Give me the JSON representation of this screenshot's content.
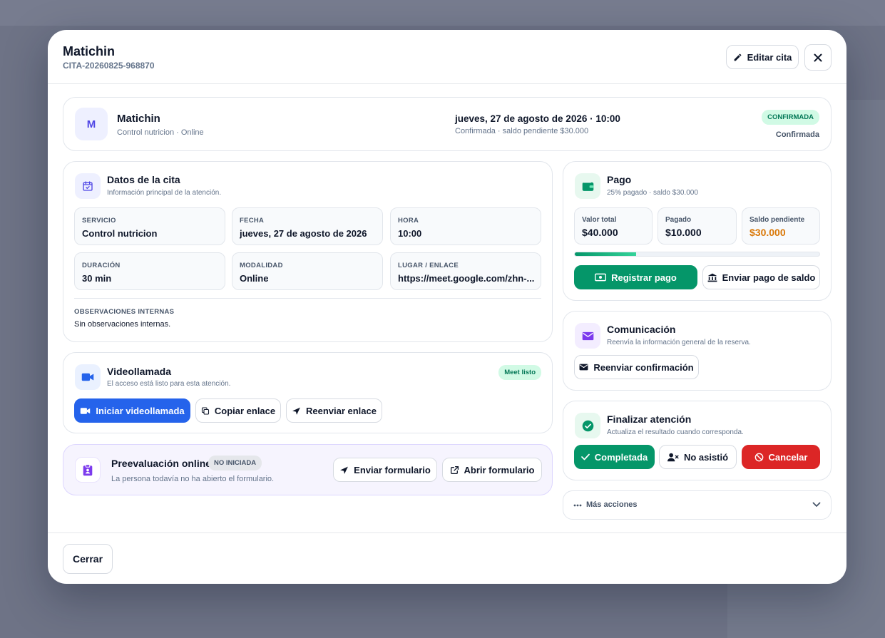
{
  "modal": {
    "title": "Matichin",
    "code": "CITA-20260825-968870",
    "edit_label": "Editar cita",
    "close_icon": "close-icon"
  },
  "summary": {
    "avatar_initial": "M",
    "name": "Matichin",
    "service_line": "Control nutricion · Online",
    "datetime": "jueves, 27 de agosto de 2026 · 10:00",
    "status_line": "Confirmada · saldo pendiente $30.000",
    "badge": "CONFIRMADA",
    "status": "Confirmada"
  },
  "details": {
    "title": "Datos de la cita",
    "subtitle": "Información principal de la atención.",
    "fields": [
      {
        "label": "SERVICIO",
        "value": "Control nutricion"
      },
      {
        "label": "FECHA",
        "value": "jueves, 27 de agosto de 2026"
      },
      {
        "label": "HORA",
        "value": "10:00"
      },
      {
        "label": "DURACIÓN",
        "value": "30 min"
      },
      {
        "label": "MODALIDAD",
        "value": "Online"
      },
      {
        "label": "LUGAR / ENLACE",
        "value": "https://meet.google.com/zhn-..."
      }
    ],
    "notes_label": "OBSERVACIONES INTERNAS",
    "notes_value": "Sin observaciones internas."
  },
  "video": {
    "title": "Videollamada",
    "subtitle": "El acceso está listo para esta atención.",
    "badge": "Meet listo",
    "start_label": "Iniciar videollamada",
    "copy_label": "Copiar enlace",
    "resend_label": "Reenviar enlace"
  },
  "pre_eval": {
    "title": "Preevaluación online",
    "badge": "NO INICIADA",
    "subtitle": "La persona todavía no ha abierto el formulario.",
    "send_label": "Enviar formulario",
    "open_label": "Abrir formulario"
  },
  "payment": {
    "title": "Pago",
    "subtitle": "25% pagado · saldo $30.000",
    "total_label": "Valor total",
    "total_value": "$40.000",
    "paid_label": "Pagado",
    "paid_value": "$10.000",
    "pending_label": "Saldo pendiente",
    "pending_value": "$30.000",
    "progress_fraction": 0.25,
    "register_label": "Registrar pago",
    "send_balance_label": "Enviar pago de saldo"
  },
  "communication": {
    "title": "Comunicación",
    "subtitle": "Reenvía la información general de la reserva.",
    "resend_label": "Reenviar confirmación"
  },
  "finish": {
    "title": "Finalizar atención",
    "subtitle": "Actualiza el resultado cuando corresponda.",
    "completed_label": "Completada",
    "no_show_label": "No asistió",
    "cancel_label": "Cancelar"
  },
  "more_actions": {
    "label": "Más acciones"
  },
  "footer": {
    "close_label": "Cerrar"
  },
  "colors": {
    "accent_blue": "#2563eb",
    "accent_green": "#059669",
    "danger": "#dc2626",
    "pending_amount": "#d97706",
    "purple": "#7c3aed"
  }
}
